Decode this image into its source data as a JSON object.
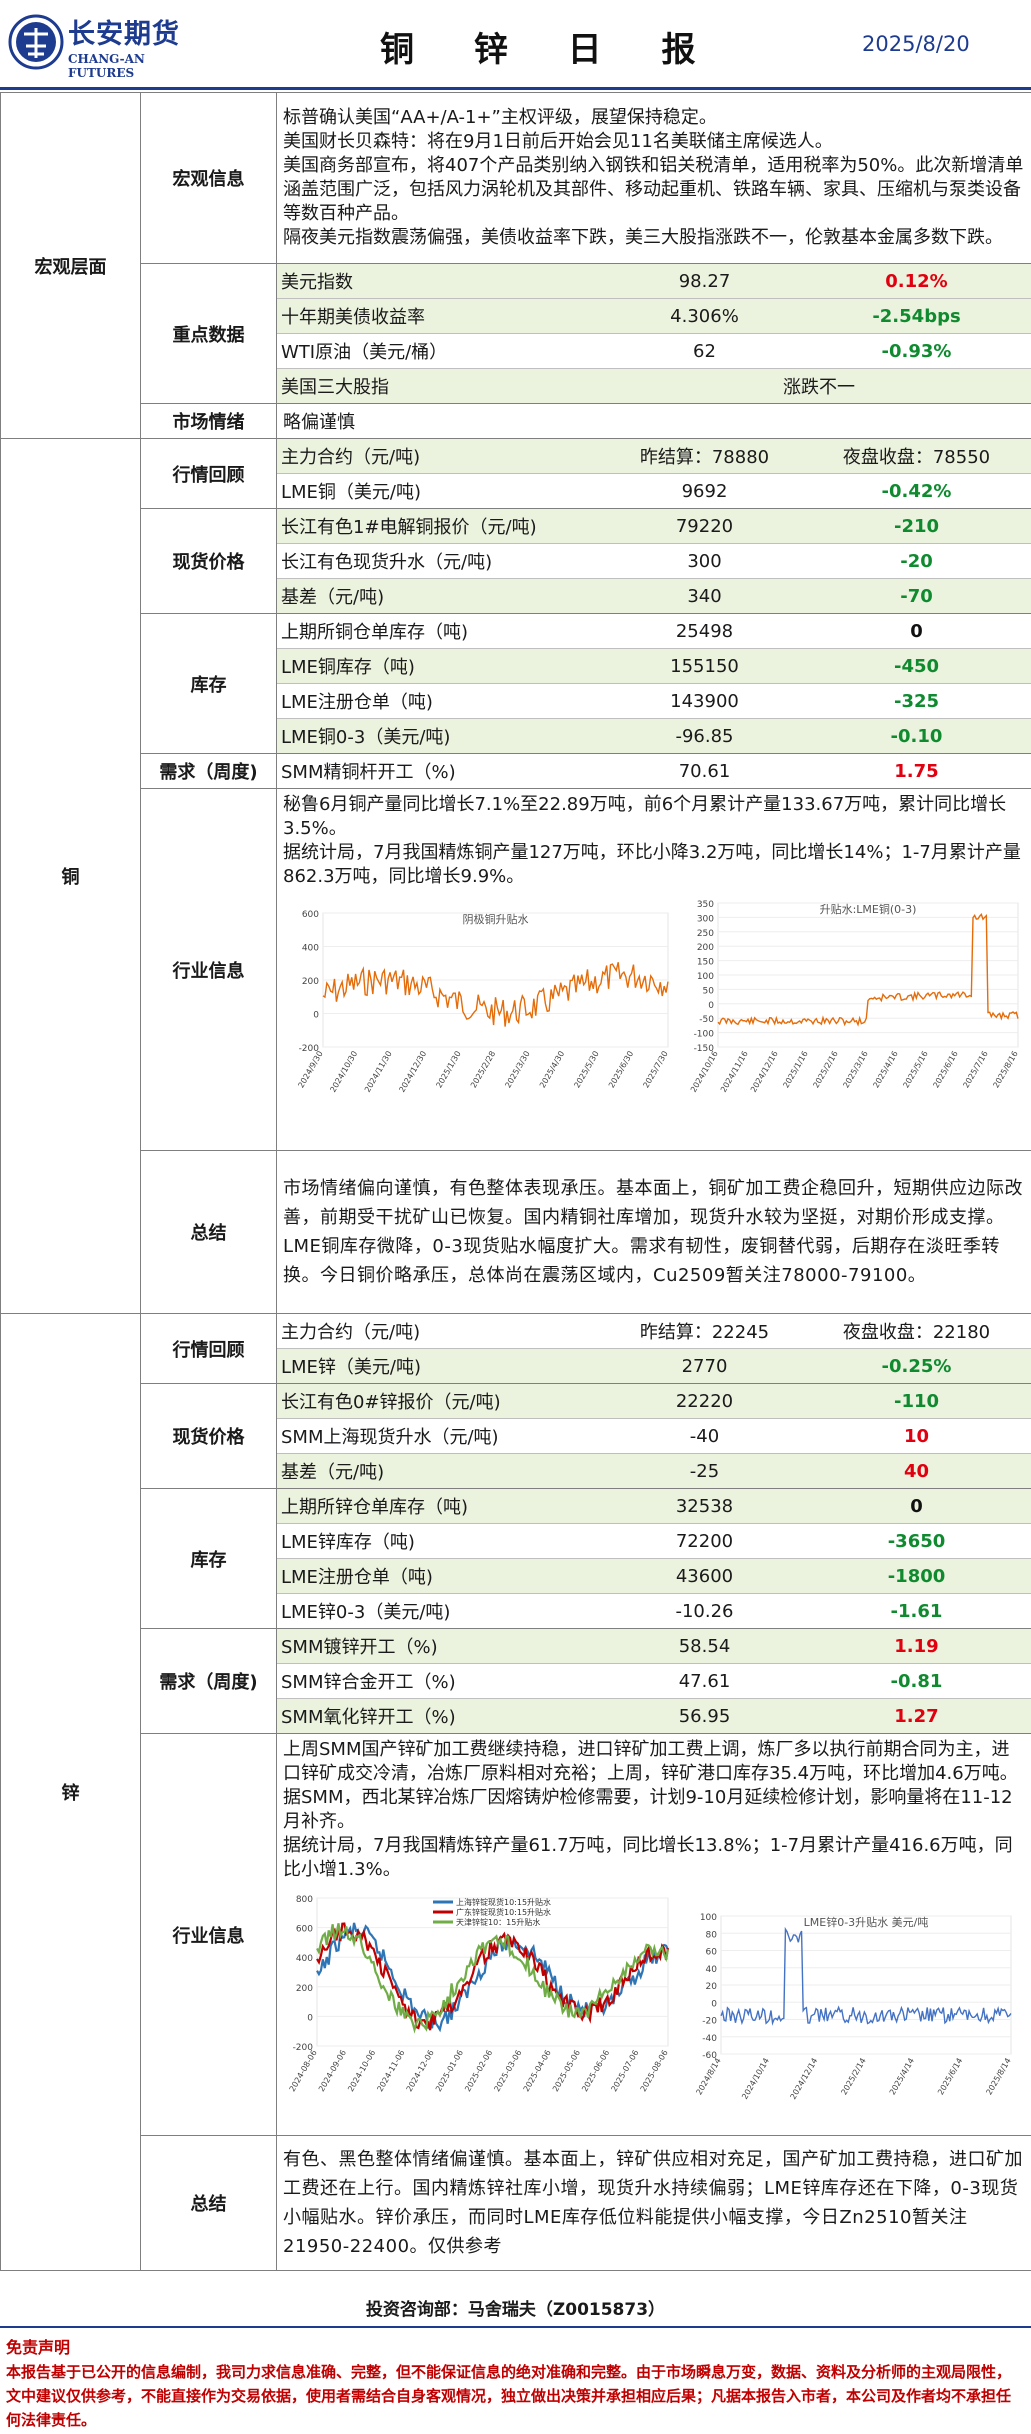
{
  "header": {
    "logo_cn": "长安期货",
    "logo_en": "CHANG-AN FUTURES",
    "title": "铜 锌 日 报",
    "date": "2025/8/20"
  },
  "macro": {
    "section": "宏观层面",
    "info_label": "宏观信息",
    "info_lines": [
      "标普确认美国“AA+/A-1+”主权评级，展望保持稳定。",
      "美国财长贝森特：将在9月1日前后开始会见11名美联储主席候选人。",
      "美国商务部宣布，将407个产品类别纳入钢铁和铝关税清单，适用税率为50%。此次新增清单涵盖范围广泛，包括风力涡轮机及其部件、移动起重机、铁路车辆、家具、压缩机与泵类设备等数百种产品。",
      "隔夜美元指数震荡偏强，美债收益率下跌，美三大股指涨跌不一，伦敦基本金属多数下跌。"
    ],
    "data_label": "重点数据",
    "data_rows": [
      {
        "name": "美元指数",
        "value": "98.27",
        "change": "0.12%",
        "color": "red"
      },
      {
        "name": "十年期美债收益率",
        "value": "4.306%",
        "change": "-2.54bps",
        "color": "grn"
      },
      {
        "name": "WTI原油（美元/桶）",
        "value": "62",
        "change": "-0.93%",
        "color": "grn"
      }
    ],
    "stocks_name": "美国三大股指",
    "stocks_value": "涨跌不一",
    "sentiment_label": "市场情绪",
    "sentiment_value": "略偏谨慎"
  },
  "copper": {
    "section": "铜",
    "review_label": "行情回顾",
    "review_rows": [
      {
        "name": "主力合约（元/吨)",
        "value": "昨结算：78880",
        "change": "夜盘收盘：78550",
        "color": "blk"
      },
      {
        "name": "LME铜（美元/吨)",
        "value": "9692",
        "change": "-0.42%",
        "color": "grn"
      }
    ],
    "spot_label": "现货价格",
    "spot_rows": [
      {
        "name": "长江有色1#电解铜报价（元/吨)",
        "value": "79220",
        "change": "-210",
        "color": "grn"
      },
      {
        "name": "长江有色现货升水（元/吨)",
        "value": "300",
        "change": "-20",
        "color": "grn"
      },
      {
        "name": "基差（元/吨)",
        "value": "340",
        "change": "-70",
        "color": "grn"
      }
    ],
    "stock_label": "库存",
    "stock_rows": [
      {
        "name": "上期所铜仓单库存（吨)",
        "value": "25498",
        "change": "0",
        "color": "blk"
      },
      {
        "name": "LME铜库存（吨)",
        "value": "155150",
        "change": "-450",
        "color": "grn"
      },
      {
        "name": "LME注册仓单（吨)",
        "value": "143900",
        "change": "-325",
        "color": "grn"
      },
      {
        "name": "LME铜0-3（美元/吨)",
        "value": "-96.85",
        "change": "-0.10",
        "color": "grn"
      }
    ],
    "demand_label": "需求（周度)",
    "demand_rows": [
      {
        "name": "SMM精铜杆开工（%)",
        "value": "70.61",
        "change": "1.75",
        "color": "red"
      }
    ],
    "industry_label": "行业信息",
    "industry_lines": [
      "秘鲁6月铜产量同比增长7.1%至22.89万吨，前6个月累计产量133.67万吨，累计同比增长3.5%。",
      "据统计局，7月我国精炼铜产量127万吨，环比小降3.2万吨，同比增长14%；1-7月累计产量862.3万吨，同比增长9.9%。"
    ],
    "summary_label": "总结",
    "summary": "市场情绪偏向谨慎，有色整体表现承压。基本面上，铜矿加工费企稳回升，短期供应边际改善，前期受干扰矿山已恢复。国内精铜社库增加，现货升水较为坚挺，对期价形成支撑。LME铜库存微降，0-3现货贴水幅度扩大。需求有韧性，废铜替代弱，后期存在淡旺季转换。今日铜价略承压，总体尚在震荡区域内，Cu2509暂关注78000-79100。"
  },
  "zinc": {
    "section": "锌",
    "review_label": "行情回顾",
    "review_rows": [
      {
        "name": "主力合约（元/吨)",
        "value": "昨结算：22245",
        "change": "夜盘收盘：22180",
        "color": "blk"
      },
      {
        "name": "LME锌（美元/吨)",
        "value": "2770",
        "change": "-0.25%",
        "color": "grn"
      }
    ],
    "spot_label": "现货价格",
    "spot_rows": [
      {
        "name": "长江有色0#锌报价（元/吨)",
        "value": "22220",
        "change": "-110",
        "color": "grn"
      },
      {
        "name": "SMM上海现货升水（元/吨)",
        "value": "-40",
        "change": "10",
        "color": "red"
      },
      {
        "name": "基差（元/吨)",
        "value": "-25",
        "change": "40",
        "color": "red"
      }
    ],
    "stock_label": "库存",
    "stock_rows": [
      {
        "name": "上期所锌仓单库存（吨)",
        "value": "32538",
        "change": "0",
        "color": "blk"
      },
      {
        "name": "LME锌库存（吨)",
        "value": "72200",
        "change": "-3650",
        "color": "grn"
      },
      {
        "name": "LME注册仓单（吨)",
        "value": "43600",
        "change": "-1800",
        "color": "grn"
      },
      {
        "name": "LME锌0-3（美元/吨)",
        "value": "-10.26",
        "change": "-1.61",
        "color": "grn"
      }
    ],
    "demand_label": "需求（周度)",
    "demand_rows": [
      {
        "name": "SMM镀锌开工（%)",
        "value": "58.54",
        "change": "1.19",
        "color": "red"
      },
      {
        "name": "SMM锌合金开工（%)",
        "value": "47.61",
        "change": "-0.81",
        "color": "grn"
      },
      {
        "name": "SMM氧化锌开工（%)",
        "value": "56.95",
        "change": "1.27",
        "color": "red"
      }
    ],
    "industry_label": "行业信息",
    "industry_lines": [
      "上周SMM国产锌矿加工费继续持稳，进口锌矿加工费上调，炼厂多以执行前期合同为主，进口锌矿成交冷清，冶炼厂原料相对充裕；上周，锌矿港口库存35.4万吨，环比增加4.6万吨。",
      "据SMM，西北某锌冶炼厂因熔铸炉检修需要，计划9-10月延续检修计划，影响量将在11-12月补齐。",
      "据统计局，7月我国精炼锌产量61.7万吨，同比增长13.8%；1-7月累计产量416.6万吨，同比小增1.3%。"
    ],
    "summary_label": "总结",
    "summary": "有色、黑色整体情绪偏谨慎。基本面上，锌矿供应相对充足，国产矿加工费持稳，进口矿加工费还在上行。国内精炼锌社库小增，现货升水持续偏弱；LME锌库存还在下降，0-3现货小幅贴水。锌价承压，而同时LME库存低位料能提供小幅支撑，今日Zn2510暂关注21950-22400。仅供参考"
  },
  "charts": {
    "cu_left": {
      "title": "阴极铜升贴水",
      "yticks": [
        "600",
        "400",
        "200",
        "0",
        "-200"
      ],
      "xticks": [
        "2024/9/30",
        "2024/10/30",
        "2024/11/30",
        "2024/12/30",
        "2025/1/30",
        "2025/2/28",
        "2025/3/30",
        "2025/4/30",
        "2025/5/30",
        "2025/6/30",
        "2025/7/30"
      ]
    },
    "cu_right": {
      "title": "升贴水:LME铜(0-3)",
      "yticks": [
        "350",
        "300",
        "250",
        "200",
        "150",
        "100",
        "50",
        "0",
        "-50",
        "-100",
        "-150"
      ],
      "xticks": [
        "2024/10/16",
        "2024/11/16",
        "2024/12/16",
        "2025/1/16",
        "2025/2/16",
        "2025/3/16",
        "2025/4/16",
        "2025/5/16",
        "2025/6/16",
        "2025/7/16",
        "2025/8/16"
      ]
    },
    "zn_left": {
      "legend": [
        "上海锌锭现货10:15升贴水",
        "广东锌锭现货10:15升贴水",
        "天津锌锭10：15升贴水"
      ],
      "colors": [
        "#2e75b6",
        "#c00000",
        "#70ad47"
      ],
      "yticks": [
        "800",
        "600",
        "400",
        "200",
        "0",
        "-200"
      ],
      "xticks": [
        "2024-08-06",
        "2024-09-06",
        "2024-10-06",
        "2024-11-06",
        "2024-12-06",
        "2025-01-06",
        "2025-02-06",
        "2025-03-06",
        "2025-04-06",
        "2025-05-06",
        "2025-06-06",
        "2025-07-06",
        "2025-08-06"
      ]
    },
    "zn_right": {
      "title": "LME锌0-3升贴水 美元/吨",
      "yticks": [
        "100",
        "80",
        "60",
        "40",
        "20",
        "0",
        "-20",
        "-40",
        "-60"
      ],
      "xticks": [
        "2024/8/14",
        "2024/10/14",
        "2024/12/14",
        "2025/2/14",
        "2025/4/14",
        "2025/6/14",
        "2025/8/14"
      ]
    }
  },
  "footer": {
    "contact": "投资咨询部：马舍瑞夫（Z0015873）",
    "disclaimer_title": "免责声明",
    "disclaimer": "本报告基于已公开的信息编制，我司力求信息准确、完整，但不能保证信息的绝对准确和完整。由于市场瞬息万变，数据、资料及分析师的主观局限性，文中建议仅供参考，不能直接作为交易依据，使用者需结合自身客观情况，独立做出决策并承担相应后果；凡据本报告入市者，本公司及作者均不承担任何法律责任。"
  }
}
